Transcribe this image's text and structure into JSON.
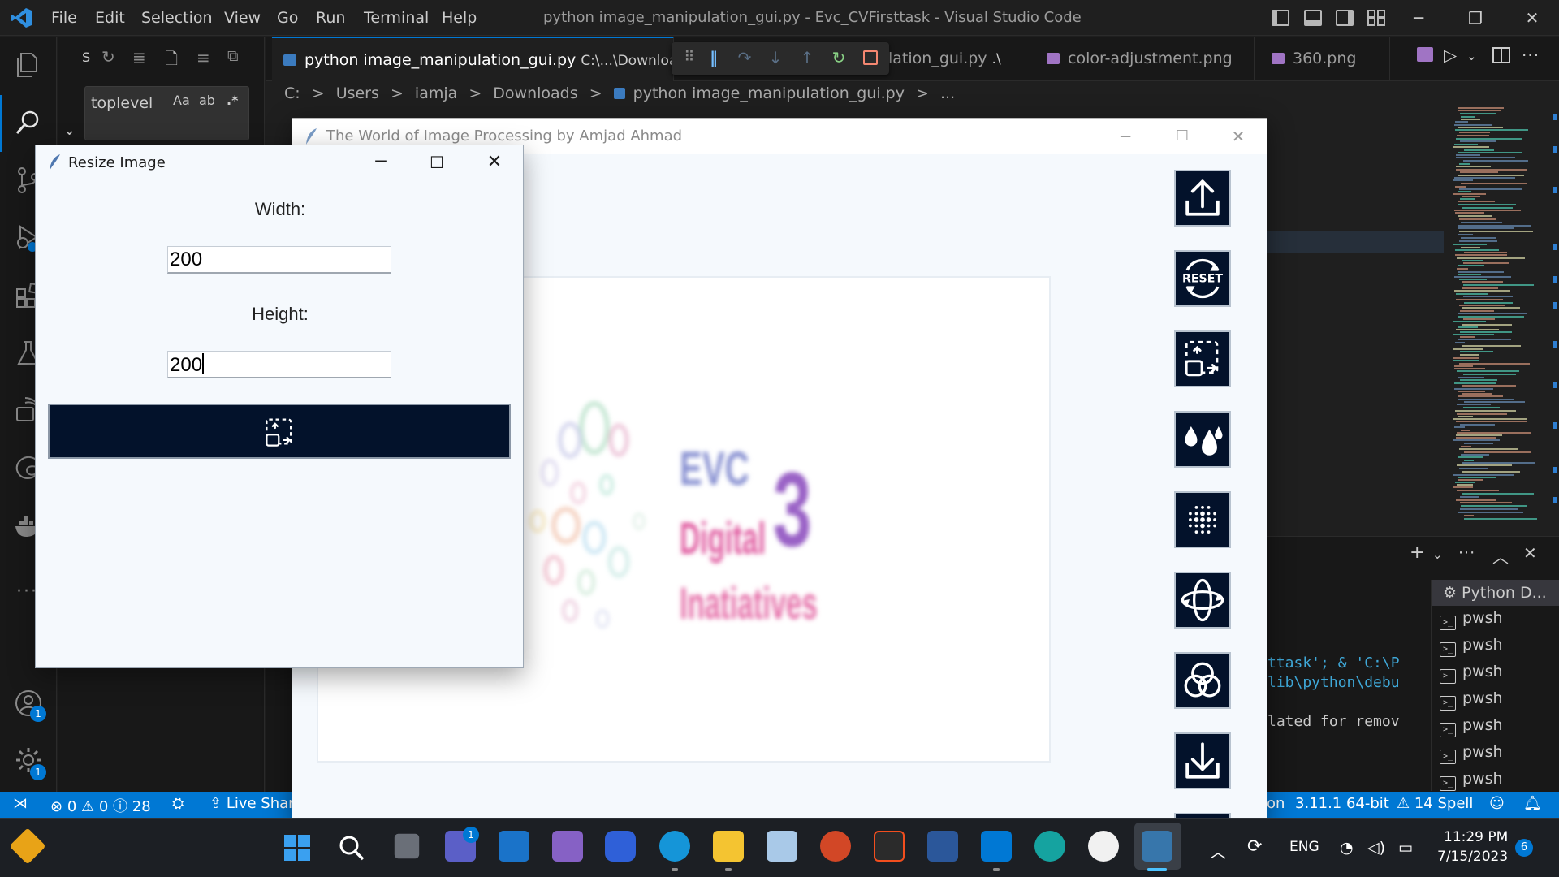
{
  "vscode": {
    "menu": [
      "File",
      "Edit",
      "Selection",
      "View",
      "Go",
      "Run",
      "Terminal",
      "Help"
    ],
    "window_title": "python image_manipulation_gui.py - Evc_CVFirsttask - Visual Studio Code",
    "search": {
      "header_letter": "S",
      "query": "toplevel",
      "opt_case": "Aa",
      "opt_word": "ab",
      "opt_regex": ".*"
    },
    "tabs": [
      {
        "label": "python image_manipulation_gui.py",
        "desc": "C:\\...\\Downloads",
        "active": true
      },
      {
        "label": "lation_gui.py",
        "desc": ".\\",
        "active": false
      },
      {
        "label": "color-adjustment.png",
        "desc": "",
        "active": false
      },
      {
        "label": "360.png",
        "desc": "",
        "active": false
      }
    ],
    "breadcrumb": [
      "C:",
      ">",
      "Users",
      ">",
      "iamja",
      ">",
      "Downloads",
      ">",
      "python image_manipulation_gui.py",
      ">",
      "..."
    ],
    "terminal": {
      "lines": [
        "ttask'; & 'C:\\P",
        "lib\\python\\debu",
        "lated for remov"
      ],
      "sessions": [
        "Python D...",
        "pwsh",
        "pwsh",
        "pwsh",
        "pwsh",
        "pwsh",
        "pwsh",
        "pwsh"
      ]
    },
    "activity_badges": {
      "accounts": "1",
      "settings": "1"
    },
    "status": {
      "errors": "0",
      "warnings": "0",
      "infos": "28",
      "live_share": "Live Share",
      "python_tail": "on",
      "python_version": "3.11.1 64-bit",
      "spell": "14 Spell"
    }
  },
  "main_window": {
    "title": "The World of Image Processing by Amjad Ahmad",
    "logo_text": [
      "EVC",
      "Digital",
      "Inatiatives",
      "3"
    ],
    "tools": [
      "upload-icon",
      "reset-icon",
      "resize-icon",
      "color-drops-icon",
      "dots-filter-icon",
      "rotate-icon",
      "color-circles-icon",
      "download-icon"
    ],
    "reset_label": "RESET"
  },
  "dialog": {
    "title": "Resize Image",
    "width_label": "Width:",
    "width_value": "200",
    "height_label": "Height:",
    "height_value": "200"
  },
  "taskbar": {
    "lang": "ENG",
    "time": "11:29 PM",
    "date": "7/15/2023",
    "notif_count": "6",
    "chat_badge": "1"
  },
  "colors": {
    "vscode_blue": "#0078d4",
    "tool_bg": "#03122b",
    "window_bg": "#f5f9fd"
  }
}
